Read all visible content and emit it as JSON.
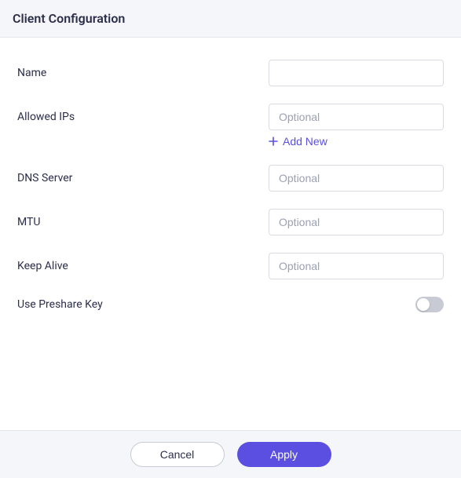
{
  "header": {
    "title": "Client Configuration"
  },
  "form": {
    "name": {
      "label": "Name",
      "value": ""
    },
    "allowed_ips": {
      "label": "Allowed IPs",
      "value": "",
      "placeholder": "Optional",
      "add_new_label": "Add New"
    },
    "dns_server": {
      "label": "DNS Server",
      "value": "",
      "placeholder": "Optional"
    },
    "mtu": {
      "label": "MTU",
      "value": "",
      "placeholder": "Optional"
    },
    "keep_alive": {
      "label": "Keep Alive",
      "value": "",
      "placeholder": "Optional"
    },
    "preshare_key": {
      "label": "Use Preshare Key",
      "enabled": false
    }
  },
  "footer": {
    "cancel_label": "Cancel",
    "apply_label": "Apply"
  },
  "colors": {
    "accent": "#5a4fe0",
    "text_primary": "#2b2e4a",
    "border": "#d9dbe3",
    "panel_bg": "#f5f6f9"
  }
}
